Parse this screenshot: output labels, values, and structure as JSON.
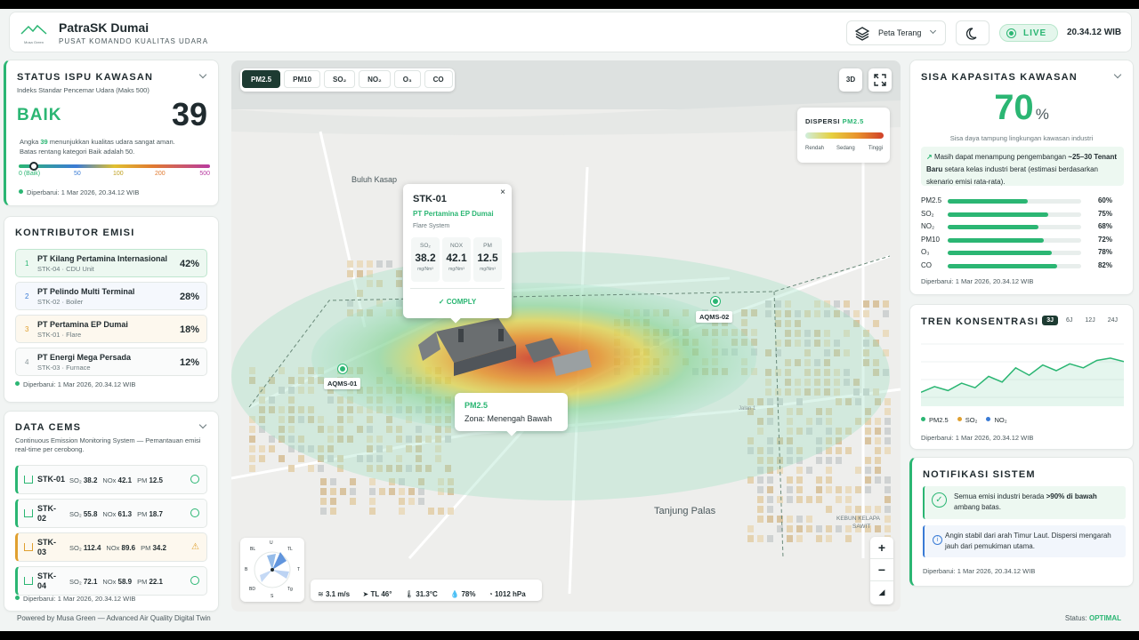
{
  "header": {
    "title": "PatraSK Dumai",
    "subtitle": "PUSAT KOMANDO KUALITAS UDARA",
    "logo_text": "Musa Green",
    "map_style": "Peta Terang",
    "live": "LIVE",
    "time": "20.34.12 WIB"
  },
  "ispu": {
    "title": "STATUS ISPU KAWASAN",
    "desc": "Indeks Standar Pencemar Udara (Maks 500)",
    "status": "BAIK",
    "value": "39",
    "note_pre": "Angka ",
    "note_value": "39",
    "note_post": " menunjukkan kualitas udara sangat aman.",
    "note2": "Batas rentang kategori Baik adalah 50.",
    "scale": [
      "0 (Baik)",
      "50",
      "100",
      "200",
      "500"
    ],
    "level_fraction": 0.078,
    "updated": "Diperbarui: 1 Mar 2026, 20.34.12 WIB"
  },
  "contributors": {
    "title": "KONTRIBUTOR EMISI",
    "items": [
      {
        "rank": "1",
        "name": "PT Kilang Pertamina Internasional",
        "sub": "STK-04 · CDU Unit",
        "pct": "42%",
        "color": "#2bb673",
        "bg": "#edf8f1"
      },
      {
        "rank": "2",
        "name": "PT Pelindo Multi Terminal",
        "sub": "STK-02 · Boiler",
        "pct": "28%",
        "color": "#3a7bd5",
        "bg": "#f5f8fd"
      },
      {
        "rank": "3",
        "name": "PT Pertamina EP Dumai",
        "sub": "STK-01 · Flare",
        "pct": "18%",
        "color": "#e0a030",
        "bg": "#fdf8ee"
      },
      {
        "rank": "4",
        "name": "PT Energi Mega Persada",
        "sub": "STK-03 · Furnace",
        "pct": "12%",
        "color": "#8a979a",
        "bg": "#fafbfb"
      }
    ],
    "updated": "Diperbarui: 1 Mar 2026, 20.34.12 WIB"
  },
  "cems": {
    "title": "DATA CEMS",
    "desc": "Continuous Emission Monitoring System — Pemantauan emisi real-time per cerobong.",
    "items": [
      {
        "id": "STK-01",
        "so2": "38.2",
        "nox": "42.1",
        "pm": "12.5",
        "state": "ok"
      },
      {
        "id": "STK-02",
        "so2": "55.8",
        "nox": "61.3",
        "pm": "18.7",
        "state": "ok"
      },
      {
        "id": "STK-03",
        "so2": "112.4",
        "nox": "89.6",
        "pm": "34.2",
        "state": "warn"
      },
      {
        "id": "STK-04",
        "so2": "72.1",
        "nox": "58.9",
        "pm": "22.1",
        "state": "ok"
      }
    ],
    "so2_label": "SO₂",
    "nox_label": "NOx",
    "pm_label": "PM",
    "updated": "Diperbarui: 1 Mar 2026, 20.34.12 WIB"
  },
  "map": {
    "tabs": [
      "PM2.5",
      "PM10",
      "SO₂",
      "NO₂",
      "O₃",
      "CO"
    ],
    "btn_3d": "3D",
    "legend": {
      "title": "DISPERSI",
      "pollutant": "PM2.5",
      "low": "Rendah",
      "mid": "Sedang",
      "high": "Tinggi"
    },
    "places": [
      "Buluh Kasap",
      "Tanjung Palas",
      "KEBUN KELAPA",
      "SAWIT",
      "Jalan 1"
    ],
    "stations": [
      "AQMS-01",
      "AQMS-02"
    ],
    "popup": {
      "id": "STK-01",
      "company": "PT Pertamina EP Dumai",
      "type": "Flare System",
      "so2_label": "SO₂",
      "so2": "38.2",
      "nox_label": "NOX",
      "nox": "42.1",
      "pm_label": "PM",
      "pm": "12.5",
      "unit": "mg/Nm³",
      "status": "✓ COMPLY"
    },
    "zone": {
      "title": "PM2.5",
      "text": "Zona: Menengah Bawah"
    },
    "compass": [
      "U",
      "TL",
      "T",
      "Tg",
      "S",
      "BD",
      "B",
      "BL"
    ],
    "weather": [
      "3.1 m/s",
      "TL 46°",
      "31.3°C",
      "78%",
      "1012 hPa"
    ],
    "zoom_in": "+",
    "zoom_out": "−",
    "reset": "◢"
  },
  "capacity": {
    "title": "SISA KAPASITAS KAWASAN",
    "value": "70",
    "unit": "%",
    "desc": "Sisa daya tampung lingkungan kawasan industri",
    "note_pre": "Masih dapat menampung pengembangan ",
    "note_bold": "~25–30 Tenant Baru",
    "note_post": " setara kelas industri berat (estimasi berdasarkan skenario emisi rata-rata).",
    "bars": [
      {
        "label": "PM2.5",
        "value": 60,
        "text": "60%"
      },
      {
        "label": "SO₂",
        "value": 75,
        "text": "75%"
      },
      {
        "label": "NO₂",
        "value": 68,
        "text": "68%"
      },
      {
        "label": "PM10",
        "value": 72,
        "text": "72%"
      },
      {
        "label": "O₃",
        "value": 78,
        "text": "78%"
      },
      {
        "label": "CO",
        "value": 82,
        "text": "82%"
      }
    ],
    "updated": "Diperbarui: 1 Mar 2026, 20.34.12 WIB"
  },
  "trend": {
    "title": "TREN KONSENTRASI",
    "ranges": [
      "3J",
      "6J",
      "12J",
      "24J"
    ],
    "legend": [
      "PM2.5",
      "SO₂",
      "NO₂"
    ],
    "legend_colors": [
      "#2bb673",
      "#e0a030",
      "#3a7bd5"
    ],
    "updated": "Diperbarui: 1 Mar 2026, 20.34.12 WIB",
    "chart_data": {
      "type": "area",
      "series": [
        {
          "values": [
            0.12,
            0.22,
            0.15,
            0.28,
            0.2,
            0.4,
            0.3,
            0.55,
            0.42,
            0.6,
            0.5,
            0.62,
            0.55,
            0.68,
            0.72,
            0.66
          ]
        }
      ]
    }
  },
  "notif": {
    "title": "NOTIFIKASI SISTEM",
    "msg1_pre": "Semua emisi industri berada ",
    "msg1_bold": ">90% di bawah",
    "msg1_post": " ambang batas.",
    "msg2": "Angin stabil dari arah Timur Laut. Dispersi mengarah jauh dari pemukiman utama.",
    "updated": "Diperbarui: 1 Mar 2026, 20.34.12 WIB"
  },
  "footer": {
    "powered": "Powered by Musa Green — Advanced Air Quality Digital Twin",
    "status_label": "Status:",
    "status": "OPTIMAL"
  }
}
